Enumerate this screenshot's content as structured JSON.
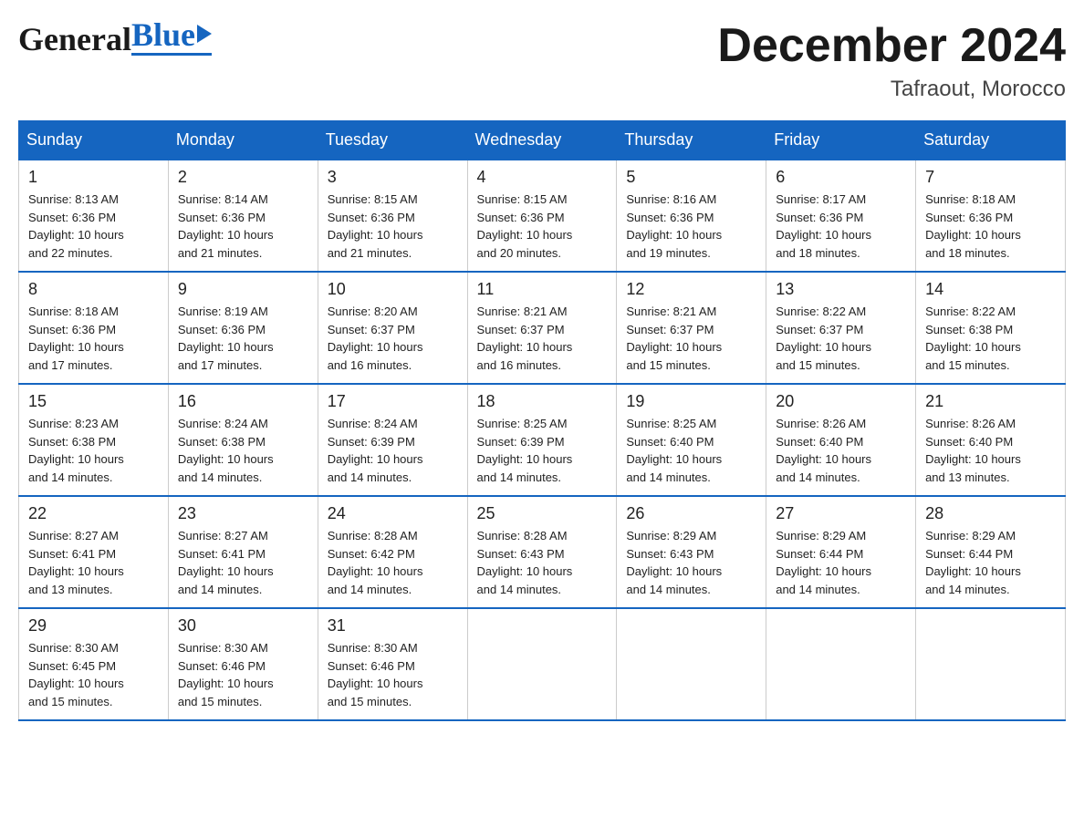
{
  "header": {
    "logo_general": "General",
    "logo_blue": "Blue",
    "month_title": "December 2024",
    "location": "Tafraout, Morocco"
  },
  "calendar": {
    "days_of_week": [
      "Sunday",
      "Monday",
      "Tuesday",
      "Wednesday",
      "Thursday",
      "Friday",
      "Saturday"
    ],
    "weeks": [
      [
        {
          "day": "1",
          "sunrise": "8:13 AM",
          "sunset": "6:36 PM",
          "daylight": "10 hours and 22 minutes."
        },
        {
          "day": "2",
          "sunrise": "8:14 AM",
          "sunset": "6:36 PM",
          "daylight": "10 hours and 21 minutes."
        },
        {
          "day": "3",
          "sunrise": "8:15 AM",
          "sunset": "6:36 PM",
          "daylight": "10 hours and 21 minutes."
        },
        {
          "day": "4",
          "sunrise": "8:15 AM",
          "sunset": "6:36 PM",
          "daylight": "10 hours and 20 minutes."
        },
        {
          "day": "5",
          "sunrise": "8:16 AM",
          "sunset": "6:36 PM",
          "daylight": "10 hours and 19 minutes."
        },
        {
          "day": "6",
          "sunrise": "8:17 AM",
          "sunset": "6:36 PM",
          "daylight": "10 hours and 18 minutes."
        },
        {
          "day": "7",
          "sunrise": "8:18 AM",
          "sunset": "6:36 PM",
          "daylight": "10 hours and 18 minutes."
        }
      ],
      [
        {
          "day": "8",
          "sunrise": "8:18 AM",
          "sunset": "6:36 PM",
          "daylight": "10 hours and 17 minutes."
        },
        {
          "day": "9",
          "sunrise": "8:19 AM",
          "sunset": "6:36 PM",
          "daylight": "10 hours and 17 minutes."
        },
        {
          "day": "10",
          "sunrise": "8:20 AM",
          "sunset": "6:37 PM",
          "daylight": "10 hours and 16 minutes."
        },
        {
          "day": "11",
          "sunrise": "8:21 AM",
          "sunset": "6:37 PM",
          "daylight": "10 hours and 16 minutes."
        },
        {
          "day": "12",
          "sunrise": "8:21 AM",
          "sunset": "6:37 PM",
          "daylight": "10 hours and 15 minutes."
        },
        {
          "day": "13",
          "sunrise": "8:22 AM",
          "sunset": "6:37 PM",
          "daylight": "10 hours and 15 minutes."
        },
        {
          "day": "14",
          "sunrise": "8:22 AM",
          "sunset": "6:38 PM",
          "daylight": "10 hours and 15 minutes."
        }
      ],
      [
        {
          "day": "15",
          "sunrise": "8:23 AM",
          "sunset": "6:38 PM",
          "daylight": "10 hours and 14 minutes."
        },
        {
          "day": "16",
          "sunrise": "8:24 AM",
          "sunset": "6:38 PM",
          "daylight": "10 hours and 14 minutes."
        },
        {
          "day": "17",
          "sunrise": "8:24 AM",
          "sunset": "6:39 PM",
          "daylight": "10 hours and 14 minutes."
        },
        {
          "day": "18",
          "sunrise": "8:25 AM",
          "sunset": "6:39 PM",
          "daylight": "10 hours and 14 minutes."
        },
        {
          "day": "19",
          "sunrise": "8:25 AM",
          "sunset": "6:40 PM",
          "daylight": "10 hours and 14 minutes."
        },
        {
          "day": "20",
          "sunrise": "8:26 AM",
          "sunset": "6:40 PM",
          "daylight": "10 hours and 14 minutes."
        },
        {
          "day": "21",
          "sunrise": "8:26 AM",
          "sunset": "6:40 PM",
          "daylight": "10 hours and 13 minutes."
        }
      ],
      [
        {
          "day": "22",
          "sunrise": "8:27 AM",
          "sunset": "6:41 PM",
          "daylight": "10 hours and 13 minutes."
        },
        {
          "day": "23",
          "sunrise": "8:27 AM",
          "sunset": "6:41 PM",
          "daylight": "10 hours and 14 minutes."
        },
        {
          "day": "24",
          "sunrise": "8:28 AM",
          "sunset": "6:42 PM",
          "daylight": "10 hours and 14 minutes."
        },
        {
          "day": "25",
          "sunrise": "8:28 AM",
          "sunset": "6:43 PM",
          "daylight": "10 hours and 14 minutes."
        },
        {
          "day": "26",
          "sunrise": "8:29 AM",
          "sunset": "6:43 PM",
          "daylight": "10 hours and 14 minutes."
        },
        {
          "day": "27",
          "sunrise": "8:29 AM",
          "sunset": "6:44 PM",
          "daylight": "10 hours and 14 minutes."
        },
        {
          "day": "28",
          "sunrise": "8:29 AM",
          "sunset": "6:44 PM",
          "daylight": "10 hours and 14 minutes."
        }
      ],
      [
        {
          "day": "29",
          "sunrise": "8:30 AM",
          "sunset": "6:45 PM",
          "daylight": "10 hours and 15 minutes."
        },
        {
          "day": "30",
          "sunrise": "8:30 AM",
          "sunset": "6:46 PM",
          "daylight": "10 hours and 15 minutes."
        },
        {
          "day": "31",
          "sunrise": "8:30 AM",
          "sunset": "6:46 PM",
          "daylight": "10 hours and 15 minutes."
        },
        null,
        null,
        null,
        null
      ]
    ],
    "sunrise_label": "Sunrise:",
    "sunset_label": "Sunset:",
    "daylight_label": "Daylight:"
  }
}
